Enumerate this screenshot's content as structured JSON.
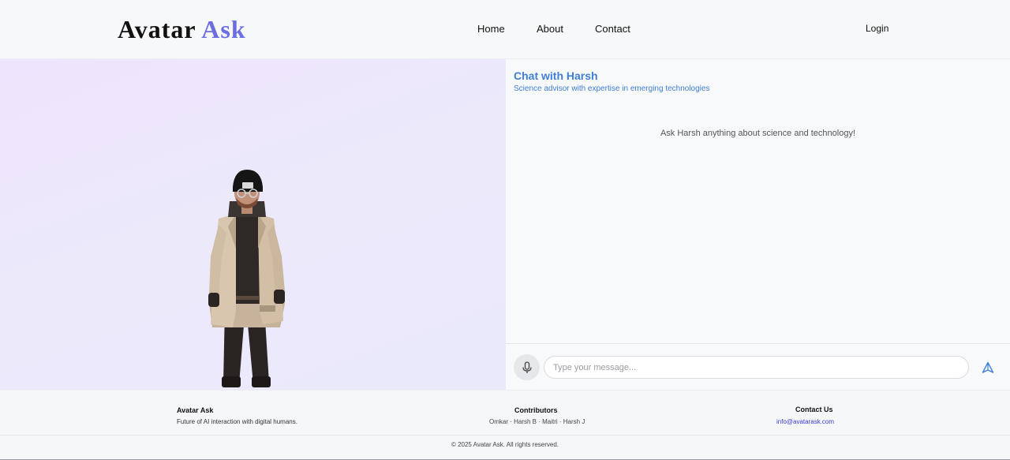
{
  "header": {
    "logo_part1": "Avatar",
    "logo_part2": "Ask",
    "nav": [
      "Home",
      "About",
      "Contact"
    ],
    "login_label": "Login"
  },
  "chat": {
    "title": "Chat with Harsh",
    "subtitle": "Science advisor with expertise in emerging technologies",
    "empty_prompt": "Ask Harsh anything about science and technology!",
    "input_placeholder": "Type your message...",
    "input_value": ""
  },
  "icons": {
    "mic": "microphone-icon",
    "send": "send-icon",
    "avatar": "3d-avatar-figure"
  },
  "footer": {
    "brand_title": "Avatar Ask",
    "brand_tagline": "Future of AI interaction with digital humans.",
    "contributors_title": "Contributors",
    "contributors_list": "Omkar · Harsh B · Maitri · Harsh J",
    "contact_title": "Contact Us",
    "contact_email": "info@avatarask.com",
    "copyright": "© 2025 Avatar Ask. All rights reserved."
  },
  "colors": {
    "brand_accent": "#6b6de0",
    "chat_accent": "#3f7fd4",
    "stage_gradient_start": "#efe4fd",
    "stage_gradient_end": "#eae9fb"
  }
}
